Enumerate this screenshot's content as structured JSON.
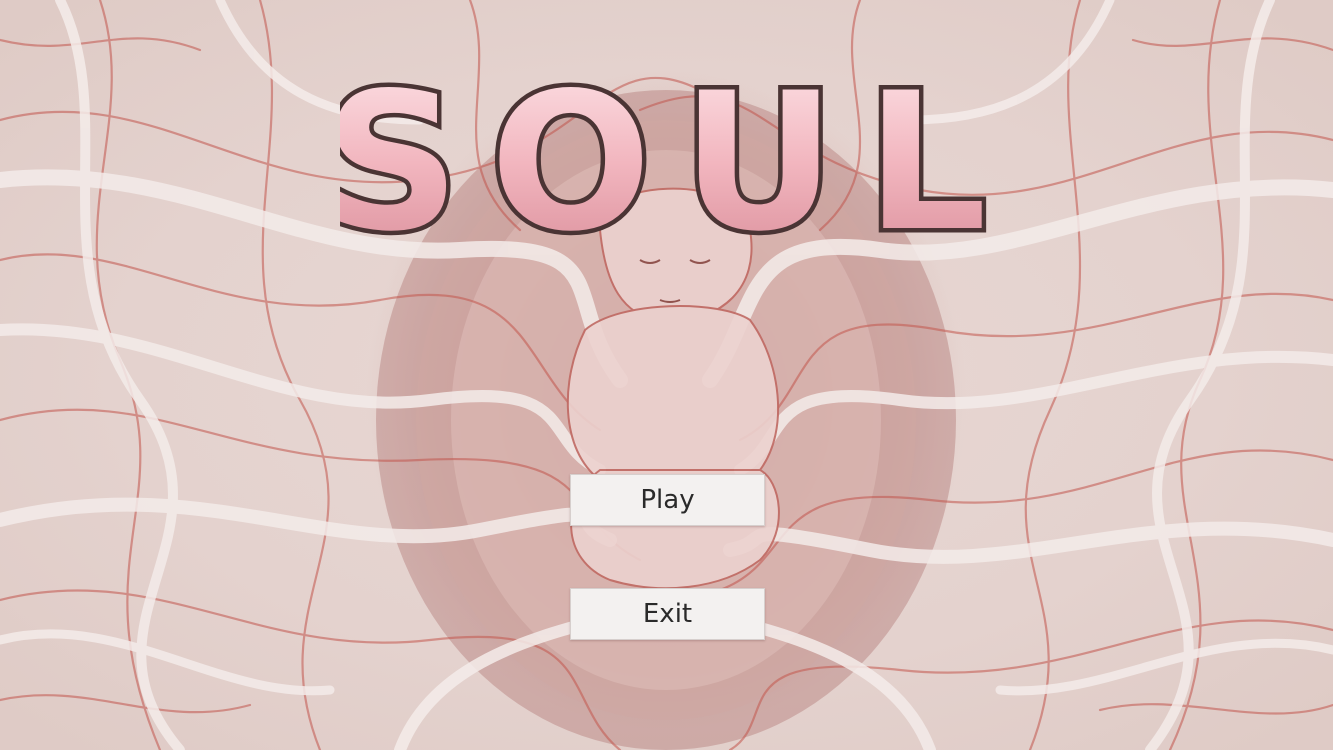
{
  "game": {
    "title": "SOUL"
  },
  "menu": {
    "play_label": "Play",
    "exit_label": "Exit"
  },
  "colors": {
    "title_fill": "#f2b6bf",
    "title_outline": "#4a3434",
    "vein_red": "#c2554d",
    "branch_white": "#f4ecea",
    "button_bg": "#f3f1f0"
  }
}
